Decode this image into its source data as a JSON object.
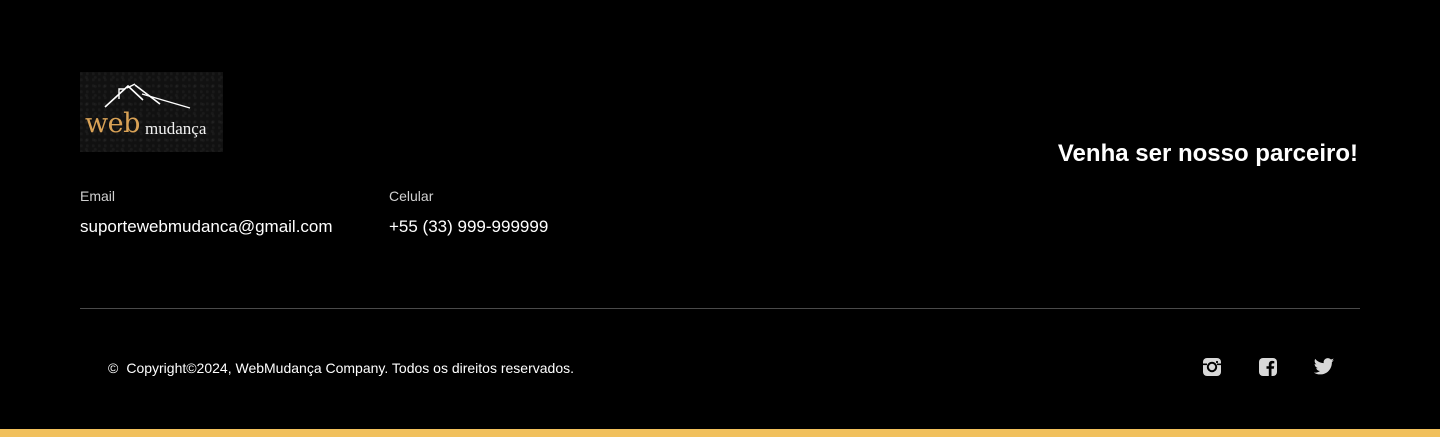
{
  "logo": {
    "word_web": "web",
    "word_mudanca": "mudança",
    "accent_color": "#d9a256"
  },
  "contact": {
    "email_label": "Email",
    "email_value": "suportewebmudanca@gmail.com",
    "phone_label": "Celular",
    "phone_value": "+55 (33) 999-999999"
  },
  "partner_heading": "Venha ser nosso parceiro!",
  "copyright": {
    "symbol": "©",
    "text": "Copyright©2024, WebMudança Company. Todos os direitos reservados."
  },
  "social": [
    {
      "icon": "instagram-icon"
    },
    {
      "icon": "facebook-icon"
    },
    {
      "icon": "twitter-icon"
    }
  ],
  "colors": {
    "background": "#000000",
    "bottom_bar": "#f1c05c",
    "divider": "#4a4a4a"
  }
}
